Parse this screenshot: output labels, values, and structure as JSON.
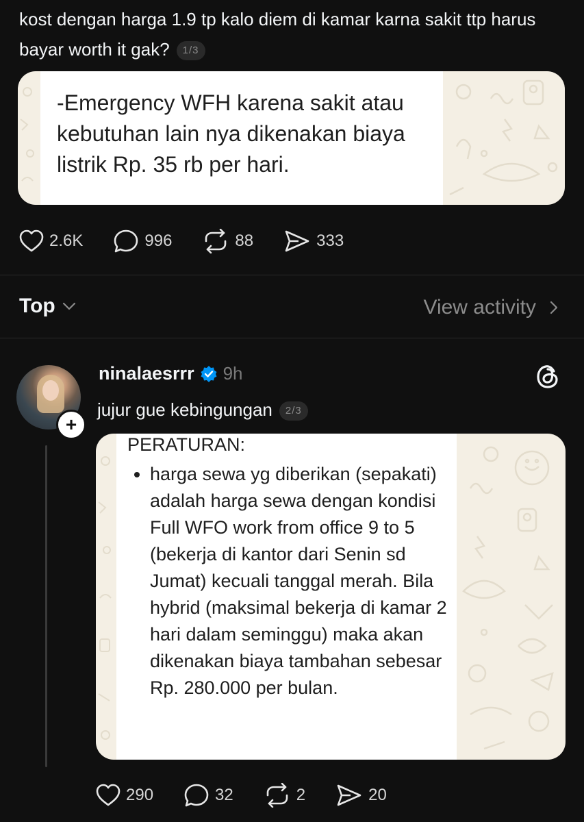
{
  "post": {
    "text": "kost dengan harga 1.9 tp kalo diem di kamar karna sakit ttp harus bayar worth it gak?",
    "page_indicator": "1/3",
    "image_text": "-Emergency WFH karena sakit atau kebutuhan lain nya dikenakan biaya listrik Rp. 35 rb per hari.",
    "likes": "2.6K",
    "comments": "996",
    "reposts": "88",
    "shares": "333"
  },
  "replies_header": {
    "sort_label": "Top",
    "view_activity": "View activity"
  },
  "reply": {
    "username": "ninalaesrrr",
    "time": "9h",
    "text": "jujur gue kebingungan",
    "page_indicator": "2/3",
    "image_heading": "PERATURAN:",
    "image_bullet": "harga sewa yg diberikan (sepakati) adalah harga sewa dengan kondisi Full WFO work from office 9 to 5 (bekerja di kantor dari Senin sd Jumat) kecuali tanggal merah. Bila hybrid (maksimal bekerja di kamar 2 hari dalam seminggu) maka akan dikenakan biaya tambahan sebesar Rp. 280.000 per bulan.",
    "likes": "290",
    "comments": "32",
    "reposts": "2",
    "shares": "20"
  },
  "icons": [
    "heart-icon",
    "comment-icon",
    "repost-icon",
    "share-icon",
    "chevron-down-icon",
    "chevron-right-icon",
    "verified-icon",
    "threads-icon",
    "plus-icon"
  ],
  "colors": {
    "background": "#101010",
    "text": "#f3f5f7",
    "muted": "#8c8c8c",
    "verified": "#0095f6",
    "card_bg": "#f4efe4"
  }
}
